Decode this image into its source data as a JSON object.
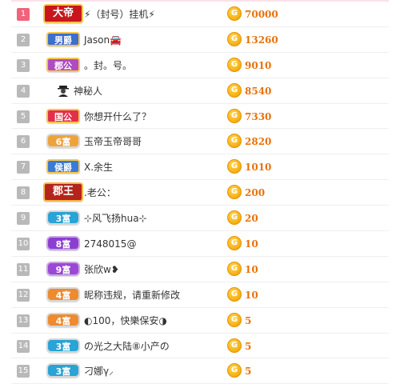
{
  "colors": {
    "top_rank": "#f0647b",
    "other_rank": "#b9b9b9",
    "score": "#e8720c",
    "coin": "#f9b318"
  },
  "rows": [
    {
      "rank": "1",
      "badge": "大帝",
      "nickname": "⚡（封号）挂机⚡",
      "coin_glyph": "G",
      "score": "70000"
    },
    {
      "rank": "2",
      "badge": "男爵",
      "nickname": "Jason🚘",
      "coin_glyph": "G",
      "score": "13260"
    },
    {
      "rank": "3",
      "badge": "郡公",
      "nickname": "。封。号。",
      "coin_glyph": "G",
      "score": "9010"
    },
    {
      "rank": "4",
      "badge": "",
      "nickname": "神秘人",
      "coin_glyph": "G",
      "score": "8540"
    },
    {
      "rank": "5",
      "badge": "国公",
      "nickname": "你想开什么了？",
      "coin_glyph": "G",
      "score": "7330"
    },
    {
      "rank": "6",
      "badge": "6富",
      "nickname": "玉帝玉帝哥哥",
      "coin_glyph": "G",
      "score": "2820"
    },
    {
      "rank": "7",
      "badge": "侯爵",
      "nickname": "X.余生",
      "coin_glyph": "G",
      "score": "1010"
    },
    {
      "rank": "8",
      "badge": "郡王",
      "nickname": ".老公：",
      "coin_glyph": "G",
      "score": "200"
    },
    {
      "rank": "9",
      "badge": "3富",
      "nickname": "⊹风飞扬hua⊹",
      "coin_glyph": "G",
      "score": "20"
    },
    {
      "rank": "10",
      "badge": "8富",
      "nickname": "2748015@",
      "coin_glyph": "G",
      "score": "10"
    },
    {
      "rank": "11",
      "badge": "9富",
      "nickname": "张欣w❥",
      "coin_glyph": "G",
      "score": "10"
    },
    {
      "rank": "12",
      "badge": "4富",
      "nickname": "昵称违规，请重新修改",
      "coin_glyph": "G",
      "score": "10"
    },
    {
      "rank": "13",
      "badge": "4富",
      "nickname": "◐100，快樂保安◑",
      "coin_glyph": "G",
      "score": "5"
    },
    {
      "rank": "14",
      "badge": "3富",
      "nickname": "の光之大陆⑧小产の",
      "coin_glyph": "G",
      "score": "5"
    },
    {
      "rank": "15",
      "badge": "3富",
      "nickname": "刁娜γ⸝",
      "coin_glyph": "G",
      "score": "5"
    }
  ]
}
